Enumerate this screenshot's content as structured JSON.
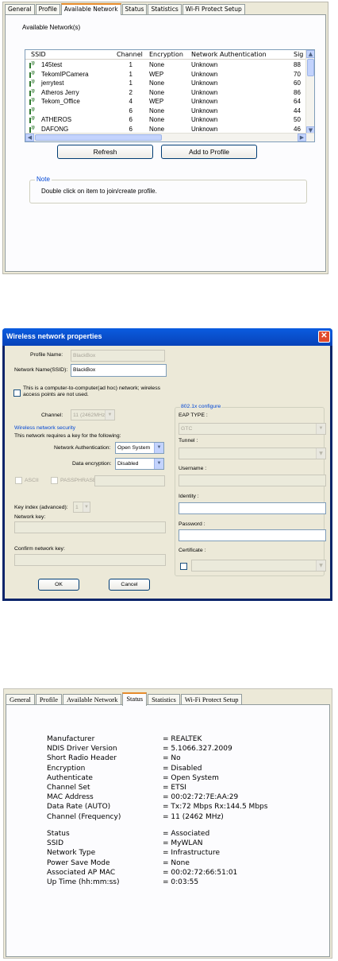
{
  "panel1": {
    "tabs": [
      "General",
      "Profile",
      "Available Network",
      "Status",
      "Statistics",
      "Wi-Fi Protect Setup"
    ],
    "active_tab": "Available Network",
    "group_label": "Available Network(s)",
    "columns": [
      "SSID",
      "Channel",
      "Encryption",
      "Network Authentication",
      "Sig"
    ],
    "networks": [
      {
        "ssid": "145test",
        "channel": "1",
        "encryption": "None",
        "auth": "Unknown",
        "signal": "88"
      },
      {
        "ssid": "TekomIPCamera",
        "channel": "1",
        "encryption": "WEP",
        "auth": "Unknown",
        "signal": "70"
      },
      {
        "ssid": "jerrytest",
        "channel": "1",
        "encryption": "None",
        "auth": "Unknown",
        "signal": "60"
      },
      {
        "ssid": "Atheros Jerry",
        "channel": "2",
        "encryption": "None",
        "auth": "Unknown",
        "signal": "86"
      },
      {
        "ssid": "Tekom_Office",
        "channel": "4",
        "encryption": "WEP",
        "auth": "Unknown",
        "signal": "64"
      },
      {
        "ssid": "",
        "channel": "6",
        "encryption": "None",
        "auth": "Unknown",
        "signal": "44"
      },
      {
        "ssid": "ATHEROS",
        "channel": "6",
        "encryption": "None",
        "auth": "Unknown",
        "signal": "50"
      },
      {
        "ssid": "DAFONG",
        "channel": "6",
        "encryption": "None",
        "auth": "Unknown",
        "signal": "46"
      }
    ],
    "refresh_label": "Refresh",
    "add_label": "Add to Profile",
    "note_title": "Note",
    "note_text": "Double click on item to join/create profile.",
    "icons": [
      "signal-icon",
      "scroll-up-icon",
      "scroll-down-icon",
      "scroll-left-icon",
      "scroll-right-icon"
    ]
  },
  "panel2": {
    "title": "Wireless network properties",
    "profile_name_label": "Profile Name:",
    "profile_name_value": "BlackBox",
    "ssid_label": "Network Name(SSID):",
    "ssid_value": "BlackBox",
    "adhoc_label_1": "This is a computer-to-computer(ad hoc) network; wireless",
    "adhoc_label_2": "access points are not used.",
    "channel_label": "Channel:",
    "channel_value": "11 (2462MHz)",
    "security_group": "Wireless network security",
    "requires_key": "This network requires a key for the following:",
    "auth_label": "Network Authentication:",
    "auth_value": "Open System",
    "enc_label": "Data encryption:",
    "enc_value": "Disabled",
    "ascii_label": "ASCII",
    "passphrase_label": "PASSPHRASE",
    "key_index_label": "Key index (advanced):",
    "key_index_value": "1",
    "network_key_label": "Network key:",
    "confirm_key_label": "Confirm network key:",
    "eap_group": "802.1x configure",
    "eap_type_label": "EAP TYPE :",
    "eap_type_value": "GTC",
    "tunnel_label": "Tunnel :",
    "username_label": "Username :",
    "identity_label": "Identity :",
    "password_label": "Password :",
    "certificate_label": "Certificate :",
    "ok_label": "OK",
    "cancel_label": "Cancel",
    "icons": [
      "close-icon",
      "chevron-down-icon"
    ]
  },
  "panel3": {
    "tabs": [
      "General",
      "Profile",
      "Available Network",
      "Status",
      "Statistics",
      "Wi-Fi Protect Setup"
    ],
    "active_tab": "Status",
    "rows1": [
      {
        "label": "Manufacturer",
        "value": "= REALTEK"
      },
      {
        "label": "NDIS Driver Version",
        "value": "= 5.1066.327.2009"
      },
      {
        "label": "Short Radio Header",
        "value": "= No"
      },
      {
        "label": "Encryption",
        "value": "= Disabled"
      },
      {
        "label": "Authenticate",
        "value": "= Open System"
      },
      {
        "label": "Channel Set",
        "value": "= ETSI"
      },
      {
        "label": "MAC Address",
        "value": "= 00:02:72:7E:AA:29"
      },
      {
        "label": "Data Rate (AUTO)",
        "value": "= Tx:72 Mbps Rx:144.5 Mbps"
      },
      {
        "label": "Channel (Frequency)",
        "value": "= 11 (2462 MHz)"
      }
    ],
    "rows2": [
      {
        "label": "Status",
        "value": "= Associated"
      },
      {
        "label": "SSID",
        "value": "= MyWLAN"
      },
      {
        "label": "Network Type",
        "value": "= Infrastructure"
      },
      {
        "label": "Power Save Mode",
        "value": "= None"
      },
      {
        "label": "Associated AP MAC",
        "value": "= 00:02:72:66:51:01"
      },
      {
        "label": "Up Time (hh:mm:ss)",
        "value": "= 0:03:55"
      }
    ]
  }
}
